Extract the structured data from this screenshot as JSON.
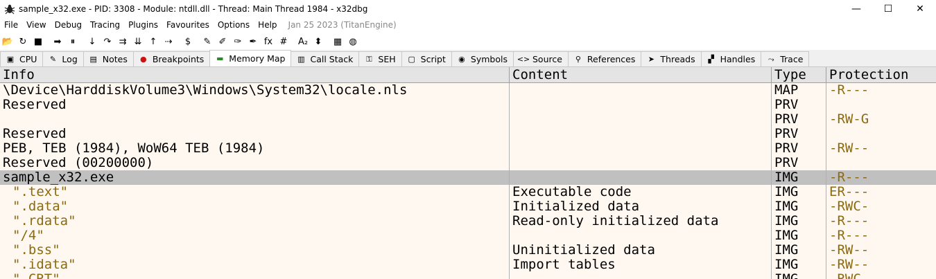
{
  "window": {
    "title": "sample_x32.exe - PID: 3308 - Module: ntdll.dll - Thread: Main Thread 1984 - x32dbg",
    "controls": [
      "—",
      "☐",
      "✕"
    ]
  },
  "menu": {
    "items": [
      "File",
      "View",
      "Debug",
      "Tracing",
      "Plugins",
      "Favourites",
      "Options",
      "Help"
    ],
    "date": "Jan 25 2023 (TitanEngine)"
  },
  "toolbar": {
    "buttons": [
      {
        "name": "open-icon",
        "glyph": "📂"
      },
      {
        "name": "restart-icon",
        "glyph": "↻"
      },
      {
        "name": "stop-icon",
        "glyph": "■"
      },
      {
        "name": "run-icon",
        "glyph": "➡"
      },
      {
        "name": "pause-icon",
        "glyph": "⏸"
      },
      {
        "name": "step-into-icon",
        "glyph": "↓"
      },
      {
        "name": "step-over-icon",
        "glyph": "↷"
      },
      {
        "name": "trace-into-icon",
        "glyph": "⇉"
      },
      {
        "name": "trace-over-icon",
        "glyph": "⇊"
      },
      {
        "name": "execute-till-return-icon",
        "glyph": "↑"
      },
      {
        "name": "run-to-user-code-icon",
        "glyph": "⇢"
      },
      {
        "name": "script-icon",
        "glyph": "$"
      },
      {
        "name": "patch-icon",
        "glyph": "✎"
      },
      {
        "name": "comments-icon",
        "glyph": "✐"
      },
      {
        "name": "labels-icon",
        "glyph": "✑"
      },
      {
        "name": "bookmarks-icon",
        "glyph": "✒"
      },
      {
        "name": "function-icon",
        "glyph": "fx"
      },
      {
        "name": "hash-icon",
        "glyph": "#"
      },
      {
        "name": "font-icon",
        "glyph": "A₂"
      },
      {
        "name": "attach-icon",
        "glyph": "⬍"
      },
      {
        "name": "calculator-icon",
        "glyph": "▦"
      },
      {
        "name": "globe-icon",
        "glyph": "◍"
      }
    ]
  },
  "tabs": [
    {
      "label": "CPU",
      "icon": "cpu-icon",
      "glyph": "▣",
      "active": false
    },
    {
      "label": "Log",
      "icon": "log-icon",
      "glyph": "✎",
      "active": false
    },
    {
      "label": "Notes",
      "icon": "notes-icon",
      "glyph": "▤",
      "active": false
    },
    {
      "label": "Breakpoints",
      "icon": "breakpoints-icon",
      "glyph": "●",
      "active": false
    },
    {
      "label": "Memory Map",
      "icon": "memory-map-icon",
      "glyph": "▬",
      "active": true
    },
    {
      "label": "Call Stack",
      "icon": "call-stack-icon",
      "glyph": "▥",
      "active": false
    },
    {
      "label": "SEH",
      "icon": "seh-icon",
      "glyph": "⚿",
      "active": false
    },
    {
      "label": "Script",
      "icon": "script-icon",
      "glyph": "▢",
      "active": false
    },
    {
      "label": "Symbols",
      "icon": "symbols-icon",
      "glyph": "◉",
      "active": false
    },
    {
      "label": "Source",
      "icon": "source-icon",
      "glyph": "<>",
      "active": false
    },
    {
      "label": "References",
      "icon": "references-icon",
      "glyph": "⚲",
      "active": false
    },
    {
      "label": "Threads",
      "icon": "threads-icon",
      "glyph": "➤",
      "active": false
    },
    {
      "label": "Handles",
      "icon": "handles-icon",
      "glyph": "▞",
      "active": false
    },
    {
      "label": "Trace",
      "icon": "trace-icon",
      "glyph": "⤳",
      "active": false
    }
  ],
  "grid": {
    "columns": [
      "Info",
      "Content",
      "Type",
      "Protection"
    ],
    "rows": [
      {
        "info": "\\Device\\HarddiskVolume3\\Windows\\System32\\locale.nls",
        "content": "",
        "type": "MAP",
        "protection": "-R---",
        "section": false,
        "selected": false
      },
      {
        "info": "Reserved",
        "content": "",
        "type": "PRV",
        "protection": "",
        "section": false,
        "selected": false
      },
      {
        "info": "",
        "content": "",
        "type": "PRV",
        "protection": "-RW-G",
        "section": false,
        "selected": false
      },
      {
        "info": "Reserved",
        "content": "",
        "type": "PRV",
        "protection": "",
        "section": false,
        "selected": false
      },
      {
        "info": "PEB, TEB (1984), WoW64 TEB (1984)",
        "content": "",
        "type": "PRV",
        "protection": "-RW--",
        "section": false,
        "selected": false
      },
      {
        "info": "Reserved (00200000)",
        "content": "",
        "type": "PRV",
        "protection": "",
        "section": false,
        "selected": false
      },
      {
        "info": "sample_x32.exe",
        "content": "",
        "type": "IMG",
        "protection": "-R---",
        "section": false,
        "selected": true
      },
      {
        "info": "\".text\"",
        "content": "Executable code",
        "type": "IMG",
        "protection": "ER---",
        "section": true,
        "selected": false
      },
      {
        "info": "\".data\"",
        "content": "Initialized data",
        "type": "IMG",
        "protection": "-RWC-",
        "section": true,
        "selected": false
      },
      {
        "info": "\".rdata\"",
        "content": "Read-only initialized data",
        "type": "IMG",
        "protection": "-R---",
        "section": true,
        "selected": false
      },
      {
        "info": "\"/4\"",
        "content": "",
        "type": "IMG",
        "protection": "-R---",
        "section": true,
        "selected": false
      },
      {
        "info": "\".bss\"",
        "content": "Uninitialized data",
        "type": "IMG",
        "protection": "-RW--",
        "section": true,
        "selected": false
      },
      {
        "info": "\".idata\"",
        "content": "Import tables",
        "type": "IMG",
        "protection": "-RW--",
        "section": true,
        "selected": false
      },
      {
        "info": "\".CRT\"",
        "content": "",
        "type": "IMG",
        "protection": "-RWC-",
        "section": true,
        "selected": false
      }
    ]
  }
}
